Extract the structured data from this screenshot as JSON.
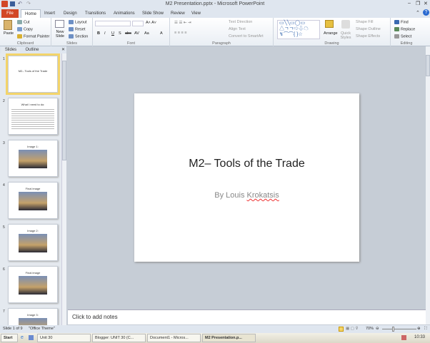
{
  "window": {
    "title": "M2 Presentation.pptx - Microsoft PowerPoint"
  },
  "tabs": [
    "File",
    "Home",
    "Insert",
    "Design",
    "Transitions",
    "Animations",
    "Slide Show",
    "Review",
    "View"
  ],
  "ribbon": {
    "clipboard": {
      "label": "Clipboard",
      "paste": "Paste",
      "cut": "Cut",
      "copy": "Copy",
      "format_painter": "Format Painter"
    },
    "slides": {
      "label": "Slides",
      "new_slide": "New Slide",
      "layout": "Layout",
      "reset": "Reset",
      "section": "Section"
    },
    "font": {
      "label": "Font",
      "bold": "B",
      "italic": "I",
      "underline": "U",
      "strike": "S",
      "shadow": "abc",
      "spacing": "AV",
      "case": "Aa",
      "color": "A"
    },
    "paragraph": {
      "label": "Paragraph",
      "text_direction": "Text Direction",
      "align_text": "Align Text",
      "convert": "Convert to SmartArt"
    },
    "drawing": {
      "label": "Drawing",
      "arrange": "Arrange",
      "quick_styles": "Quick Styles",
      "shape_fill": "Shape Fill",
      "shape_outline": "Shape Outline",
      "shape_effects": "Shape Effects"
    },
    "editing": {
      "label": "Editing",
      "find": "Find",
      "replace": "Replace",
      "select": "Select"
    }
  },
  "pane_tabs": [
    "Slides",
    "Outline"
  ],
  "thumbnails": [
    {
      "num": "1",
      "title": "M2– Tools of the Trade",
      "kind": "title"
    },
    {
      "num": "2",
      "title": "What I need to do:",
      "kind": "text"
    },
    {
      "num": "3",
      "title": "Image 1:",
      "kind": "image"
    },
    {
      "num": "4",
      "title": "Final image",
      "kind": "image"
    },
    {
      "num": "5",
      "title": "Image 2:",
      "kind": "image"
    },
    {
      "num": "6",
      "title": "Final image",
      "kind": "image"
    },
    {
      "num": "7",
      "title": "Image 3:",
      "kind": "image"
    }
  ],
  "slide": {
    "title": "M2– Tools of the Trade",
    "subtitle_prefix": "By Louis ",
    "subtitle_name": "Krokatsis"
  },
  "notes": {
    "placeholder": "Click to add notes"
  },
  "status": {
    "slide": "Slide 1 of 9",
    "theme": "\"Office Theme\"",
    "zoom": "70%"
  },
  "taskbar": {
    "start": "Start",
    "items": [
      "Unit 30",
      "Blogger: UNIT 30 (C...",
      "Document1 - Micros...",
      "M2 Presentation.p..."
    ],
    "clock": "10:33"
  },
  "colors": {
    "file_tab": "#d24726",
    "selected_thumb": "#f3d46a",
    "ribbon_bg": "#dfe6ef"
  }
}
